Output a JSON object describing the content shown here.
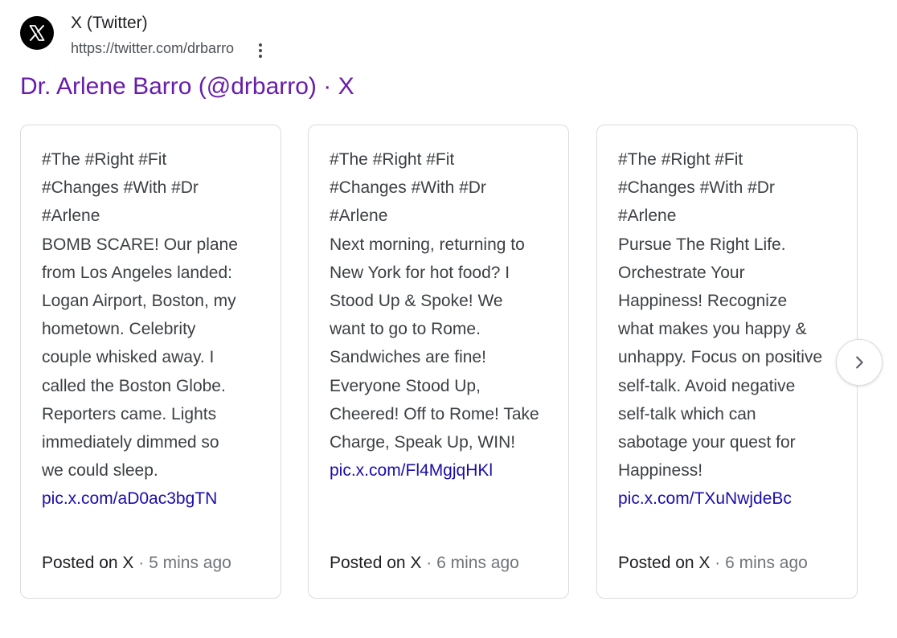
{
  "site": {
    "name": "X (Twitter)",
    "url": "https://twitter.com/drbarro",
    "logo_icon": "x-logo-icon",
    "menu_icon": "more-vert-icon"
  },
  "result": {
    "title": "Dr. Arlene Barro (@drbarro) · X"
  },
  "cards": [
    {
      "lines": [
        "#The #Right #Fit",
        "#Changes #With #Dr",
        "#Arlene",
        "BOMB SCARE! Our plane",
        "from Los Angeles landed:",
        "Logan Airport, Boston, my",
        "hometown. Celebrity",
        "couple whisked away. I",
        "called the Boston Globe.",
        "Reporters came. Lights",
        "immediately dimmed so",
        "we could sleep."
      ],
      "link": "pic.x.com/aD0ac3bgTN",
      "posted": "Posted on X",
      "separator": "·",
      "time": "5 mins ago"
    },
    {
      "lines": [
        "#The #Right #Fit",
        "#Changes #With #Dr",
        "#Arlene",
        "Next morning, returning to",
        "New York for hot food? I",
        "Stood Up & Spoke! We",
        "want to go to Rome.",
        "Sandwiches are fine!",
        "Everyone Stood Up,",
        "Cheered! Off to Rome! Take",
        "Charge, Speak Up, WIN!"
      ],
      "link": "pic.x.com/Fl4MgjqHKl",
      "posted": "Posted on X",
      "separator": "·",
      "time": "6 mins ago"
    },
    {
      "lines": [
        "#The #Right #Fit",
        "#Changes #With #Dr",
        "#Arlene",
        "Pursue The Right Life.",
        "Orchestrate Your",
        "Happiness! Recognize",
        "what makes you happy &",
        "unhappy. Focus on positive",
        "self-talk. Avoid negative",
        "self-talk which can",
        "sabotage your quest for",
        "Happiness!"
      ],
      "link": "pic.x.com/TXuNwjdeBc",
      "posted": "Posted on X",
      "separator": "·",
      "time": "6 mins ago"
    }
  ],
  "carousel": {
    "next_icon": "chevron-right-icon"
  },
  "colors": {
    "title_visited": "#681da8",
    "link": "#1a0dab",
    "body_text": "#3c4043",
    "meta_text": "#70757a",
    "card_border": "#dadce0"
  }
}
